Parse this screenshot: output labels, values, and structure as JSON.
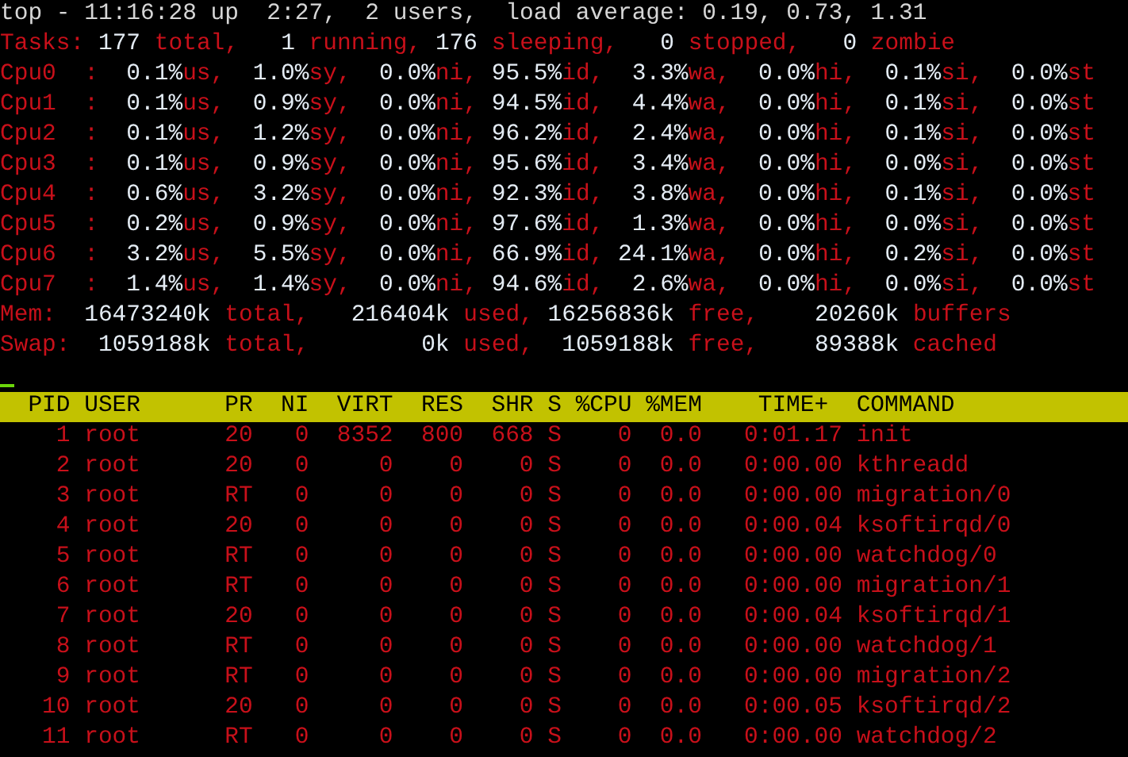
{
  "summary_lines": [
    {
      "segments": [
        {
          "kind": "plain",
          "text": "top - 11:16:28 up  2:27,  2 users,  load average: 0.19, 0.73, 1.31"
        }
      ]
    },
    {
      "segments": [
        {
          "kind": "label",
          "text": "Tasks:"
        },
        {
          "kind": "value",
          "text": " 177 "
        },
        {
          "kind": "label",
          "text": "total,"
        },
        {
          "kind": "value",
          "text": "   1 "
        },
        {
          "kind": "label",
          "text": "running,"
        },
        {
          "kind": "value",
          "text": " 176 "
        },
        {
          "kind": "label",
          "text": "sleeping,"
        },
        {
          "kind": "value",
          "text": "   0 "
        },
        {
          "kind": "label",
          "text": "stopped,"
        },
        {
          "kind": "value",
          "text": "   0 "
        },
        {
          "kind": "label",
          "text": "zombie"
        }
      ]
    },
    {
      "segments": [
        {
          "kind": "label",
          "text": "Cpu0  :"
        },
        {
          "kind": "value",
          "text": "  0.1%"
        },
        {
          "kind": "label",
          "text": "us,"
        },
        {
          "kind": "value",
          "text": "  1.0%"
        },
        {
          "kind": "label",
          "text": "sy,"
        },
        {
          "kind": "value",
          "text": "  0.0%"
        },
        {
          "kind": "label",
          "text": "ni,"
        },
        {
          "kind": "value",
          "text": " 95.5%"
        },
        {
          "kind": "label",
          "text": "id,"
        },
        {
          "kind": "value",
          "text": "  3.3%"
        },
        {
          "kind": "label",
          "text": "wa,"
        },
        {
          "kind": "value",
          "text": "  0.0%"
        },
        {
          "kind": "label",
          "text": "hi,"
        },
        {
          "kind": "value",
          "text": "  0.1%"
        },
        {
          "kind": "label",
          "text": "si,"
        },
        {
          "kind": "value",
          "text": "  0.0%"
        },
        {
          "kind": "label",
          "text": "st"
        }
      ]
    },
    {
      "segments": [
        {
          "kind": "label",
          "text": "Cpu1  :"
        },
        {
          "kind": "value",
          "text": "  0.1%"
        },
        {
          "kind": "label",
          "text": "us,"
        },
        {
          "kind": "value",
          "text": "  0.9%"
        },
        {
          "kind": "label",
          "text": "sy,"
        },
        {
          "kind": "value",
          "text": "  0.0%"
        },
        {
          "kind": "label",
          "text": "ni,"
        },
        {
          "kind": "value",
          "text": " 94.5%"
        },
        {
          "kind": "label",
          "text": "id,"
        },
        {
          "kind": "value",
          "text": "  4.4%"
        },
        {
          "kind": "label",
          "text": "wa,"
        },
        {
          "kind": "value",
          "text": "  0.0%"
        },
        {
          "kind": "label",
          "text": "hi,"
        },
        {
          "kind": "value",
          "text": "  0.1%"
        },
        {
          "kind": "label",
          "text": "si,"
        },
        {
          "kind": "value",
          "text": "  0.0%"
        },
        {
          "kind": "label",
          "text": "st"
        }
      ]
    },
    {
      "segments": [
        {
          "kind": "label",
          "text": "Cpu2  :"
        },
        {
          "kind": "value",
          "text": "  0.1%"
        },
        {
          "kind": "label",
          "text": "us,"
        },
        {
          "kind": "value",
          "text": "  1.2%"
        },
        {
          "kind": "label",
          "text": "sy,"
        },
        {
          "kind": "value",
          "text": "  0.0%"
        },
        {
          "kind": "label",
          "text": "ni,"
        },
        {
          "kind": "value",
          "text": " 96.2%"
        },
        {
          "kind": "label",
          "text": "id,"
        },
        {
          "kind": "value",
          "text": "  2.4%"
        },
        {
          "kind": "label",
          "text": "wa,"
        },
        {
          "kind": "value",
          "text": "  0.0%"
        },
        {
          "kind": "label",
          "text": "hi,"
        },
        {
          "kind": "value",
          "text": "  0.1%"
        },
        {
          "kind": "label",
          "text": "si,"
        },
        {
          "kind": "value",
          "text": "  0.0%"
        },
        {
          "kind": "label",
          "text": "st"
        }
      ]
    },
    {
      "segments": [
        {
          "kind": "label",
          "text": "Cpu3  :"
        },
        {
          "kind": "value",
          "text": "  0.1%"
        },
        {
          "kind": "label",
          "text": "us,"
        },
        {
          "kind": "value",
          "text": "  0.9%"
        },
        {
          "kind": "label",
          "text": "sy,"
        },
        {
          "kind": "value",
          "text": "  0.0%"
        },
        {
          "kind": "label",
          "text": "ni,"
        },
        {
          "kind": "value",
          "text": " 95.6%"
        },
        {
          "kind": "label",
          "text": "id,"
        },
        {
          "kind": "value",
          "text": "  3.4%"
        },
        {
          "kind": "label",
          "text": "wa,"
        },
        {
          "kind": "value",
          "text": "  0.0%"
        },
        {
          "kind": "label",
          "text": "hi,"
        },
        {
          "kind": "value",
          "text": "  0.0%"
        },
        {
          "kind": "label",
          "text": "si,"
        },
        {
          "kind": "value",
          "text": "  0.0%"
        },
        {
          "kind": "label",
          "text": "st"
        }
      ]
    },
    {
      "segments": [
        {
          "kind": "label",
          "text": "Cpu4  :"
        },
        {
          "kind": "value",
          "text": "  0.6%"
        },
        {
          "kind": "label",
          "text": "us,"
        },
        {
          "kind": "value",
          "text": "  3.2%"
        },
        {
          "kind": "label",
          "text": "sy,"
        },
        {
          "kind": "value",
          "text": "  0.0%"
        },
        {
          "kind": "label",
          "text": "ni,"
        },
        {
          "kind": "value",
          "text": " 92.3%"
        },
        {
          "kind": "label",
          "text": "id,"
        },
        {
          "kind": "value",
          "text": "  3.8%"
        },
        {
          "kind": "label",
          "text": "wa,"
        },
        {
          "kind": "value",
          "text": "  0.0%"
        },
        {
          "kind": "label",
          "text": "hi,"
        },
        {
          "kind": "value",
          "text": "  0.1%"
        },
        {
          "kind": "label",
          "text": "si,"
        },
        {
          "kind": "value",
          "text": "  0.0%"
        },
        {
          "kind": "label",
          "text": "st"
        }
      ]
    },
    {
      "segments": [
        {
          "kind": "label",
          "text": "Cpu5  :"
        },
        {
          "kind": "value",
          "text": "  0.2%"
        },
        {
          "kind": "label",
          "text": "us,"
        },
        {
          "kind": "value",
          "text": "  0.9%"
        },
        {
          "kind": "label",
          "text": "sy,"
        },
        {
          "kind": "value",
          "text": "  0.0%"
        },
        {
          "kind": "label",
          "text": "ni,"
        },
        {
          "kind": "value",
          "text": " 97.6%"
        },
        {
          "kind": "label",
          "text": "id,"
        },
        {
          "kind": "value",
          "text": "  1.3%"
        },
        {
          "kind": "label",
          "text": "wa,"
        },
        {
          "kind": "value",
          "text": "  0.0%"
        },
        {
          "kind": "label",
          "text": "hi,"
        },
        {
          "kind": "value",
          "text": "  0.0%"
        },
        {
          "kind": "label",
          "text": "si,"
        },
        {
          "kind": "value",
          "text": "  0.0%"
        },
        {
          "kind": "label",
          "text": "st"
        }
      ]
    },
    {
      "segments": [
        {
          "kind": "label",
          "text": "Cpu6  :"
        },
        {
          "kind": "value",
          "text": "  3.2%"
        },
        {
          "kind": "label",
          "text": "us,"
        },
        {
          "kind": "value",
          "text": "  5.5%"
        },
        {
          "kind": "label",
          "text": "sy,"
        },
        {
          "kind": "value",
          "text": "  0.0%"
        },
        {
          "kind": "label",
          "text": "ni,"
        },
        {
          "kind": "value",
          "text": " 66.9%"
        },
        {
          "kind": "label",
          "text": "id,"
        },
        {
          "kind": "value",
          "text": " 24.1%"
        },
        {
          "kind": "label",
          "text": "wa,"
        },
        {
          "kind": "value",
          "text": "  0.0%"
        },
        {
          "kind": "label",
          "text": "hi,"
        },
        {
          "kind": "value",
          "text": "  0.2%"
        },
        {
          "kind": "label",
          "text": "si,"
        },
        {
          "kind": "value",
          "text": "  0.0%"
        },
        {
          "kind": "label",
          "text": "st"
        }
      ]
    },
    {
      "segments": [
        {
          "kind": "label",
          "text": "Cpu7  :"
        },
        {
          "kind": "value",
          "text": "  1.4%"
        },
        {
          "kind": "label",
          "text": "us,"
        },
        {
          "kind": "value",
          "text": "  1.4%"
        },
        {
          "kind": "label",
          "text": "sy,"
        },
        {
          "kind": "value",
          "text": "  0.0%"
        },
        {
          "kind": "label",
          "text": "ni,"
        },
        {
          "kind": "value",
          "text": " 94.6%"
        },
        {
          "kind": "label",
          "text": "id,"
        },
        {
          "kind": "value",
          "text": "  2.6%"
        },
        {
          "kind": "label",
          "text": "wa,"
        },
        {
          "kind": "value",
          "text": "  0.0%"
        },
        {
          "kind": "label",
          "text": "hi,"
        },
        {
          "kind": "value",
          "text": "  0.0%"
        },
        {
          "kind": "label",
          "text": "si,"
        },
        {
          "kind": "value",
          "text": "  0.0%"
        },
        {
          "kind": "label",
          "text": "st"
        }
      ]
    },
    {
      "segments": [
        {
          "kind": "label",
          "text": "Mem:"
        },
        {
          "kind": "value",
          "text": "  16473240k "
        },
        {
          "kind": "label",
          "text": "total,"
        },
        {
          "kind": "value",
          "text": "   216404k "
        },
        {
          "kind": "label",
          "text": "used,"
        },
        {
          "kind": "value",
          "text": " 16256836k "
        },
        {
          "kind": "label",
          "text": "free,"
        },
        {
          "kind": "value",
          "text": "    20260k "
        },
        {
          "kind": "label",
          "text": "buffers"
        }
      ]
    },
    {
      "segments": [
        {
          "kind": "label",
          "text": "Swap:"
        },
        {
          "kind": "value",
          "text": "  1059188k "
        },
        {
          "kind": "label",
          "text": "total,"
        },
        {
          "kind": "value",
          "text": "        0k "
        },
        {
          "kind": "label",
          "text": "used,"
        },
        {
          "kind": "value",
          "text": "  1059188k "
        },
        {
          "kind": "label",
          "text": "free,"
        },
        {
          "kind": "value",
          "text": "    89388k "
        },
        {
          "kind": "label",
          "text": "cached"
        }
      ]
    }
  ],
  "process_table": {
    "columns": [
      "PID",
      "USER",
      "PR",
      "NI",
      "VIRT",
      "RES",
      "SHR",
      "S",
      "%CPU",
      "%MEM",
      "TIME+",
      "COMMAND"
    ],
    "rows": [
      [
        "1",
        "root",
        "20",
        "0",
        "8352",
        "800",
        "668",
        "S",
        "0",
        "0.0",
        "0:01.17",
        "init"
      ],
      [
        "2",
        "root",
        "20",
        "0",
        "0",
        "0",
        "0",
        "S",
        "0",
        "0.0",
        "0:00.00",
        "kthreadd"
      ],
      [
        "3",
        "root",
        "RT",
        "0",
        "0",
        "0",
        "0",
        "S",
        "0",
        "0.0",
        "0:00.00",
        "migration/0"
      ],
      [
        "4",
        "root",
        "20",
        "0",
        "0",
        "0",
        "0",
        "S",
        "0",
        "0.0",
        "0:00.04",
        "ksoftirqd/0"
      ],
      [
        "5",
        "root",
        "RT",
        "0",
        "0",
        "0",
        "0",
        "S",
        "0",
        "0.0",
        "0:00.00",
        "watchdog/0"
      ],
      [
        "6",
        "root",
        "RT",
        "0",
        "0",
        "0",
        "0",
        "S",
        "0",
        "0.0",
        "0:00.00",
        "migration/1"
      ],
      [
        "7",
        "root",
        "20",
        "0",
        "0",
        "0",
        "0",
        "S",
        "0",
        "0.0",
        "0:00.04",
        "ksoftirqd/1"
      ],
      [
        "8",
        "root",
        "RT",
        "0",
        "0",
        "0",
        "0",
        "S",
        "0",
        "0.0",
        "0:00.00",
        "watchdog/1"
      ],
      [
        "9",
        "root",
        "RT",
        "0",
        "0",
        "0",
        "0",
        "S",
        "0",
        "0.0",
        "0:00.00",
        "migration/2"
      ],
      [
        "10",
        "root",
        "20",
        "0",
        "0",
        "0",
        "0",
        "S",
        "0",
        "0.0",
        "0:00.05",
        "ksoftirqd/2"
      ],
      [
        "11",
        "root",
        "RT",
        "0",
        "0",
        "0",
        "0",
        "S",
        "0",
        "0.0",
        "0:00.00",
        "watchdog/2"
      ]
    ]
  }
}
